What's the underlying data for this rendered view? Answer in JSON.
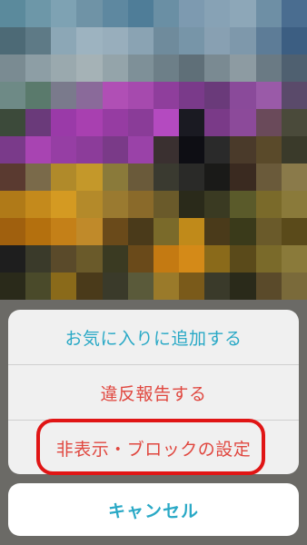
{
  "action_sheet": {
    "items": [
      {
        "label": "お気に入りに追加する",
        "color": "#2aa9c6"
      },
      {
        "label": "違反報告する",
        "color": "#e0473f"
      },
      {
        "label": "非表示・ブロックの設定",
        "color": "#e0473f"
      }
    ],
    "cancel_label": "キャンセル",
    "cancel_color": "#2aa9c6"
  },
  "annotation": {
    "highlight_color": "#e01515",
    "highlighted_item": "非表示・ブロックの設定"
  },
  "background_image": {
    "description": "pixelated mosaic photo",
    "palette": [
      "#5b8a9c",
      "#6d97a8",
      "#7ea2b3",
      "#6f93a6",
      "#5e88a0",
      "#4f7d98",
      "#6a8fa4",
      "#7d9ab0",
      "#87a2b5",
      "#8da7b8",
      "#6e8fa5",
      "#4a6d90",
      "#4d6a76",
      "#5e7a86",
      "#8ca7b6",
      "#9db3c0",
      "#98aebc",
      "#8aa3b3",
      "#6f8b9c",
      "#7795a8",
      "#88a0b2",
      "#7e98ab",
      "#5d7c97",
      "#3c5e82",
      "#7a8b92",
      "#8d9ea5",
      "#9aa9ae",
      "#a5b2b6",
      "#94a4aa",
      "#7e9098",
      "#6d7f88",
      "#5f6f78",
      "#7a8a92",
      "#8d9ba2",
      "#6a7a84",
      "#4f6070",
      "#6e8a86",
      "#5a7a6c",
      "#7a7a8c",
      "#8a6a9a",
      "#b04fb5",
      "#a64aae",
      "#8f3e9c",
      "#7a3a8a",
      "#6a3a7a",
      "#8a4a9a",
      "#9a5aa8",
      "#5a4a6a",
      "#3c4a3a",
      "#6a3a7a",
      "#9a3aa8",
      "#a840b0",
      "#963ca2",
      "#8a3c98",
      "#b44ac0",
      "#1a1a22",
      "#7a3a88",
      "#8c4a9a",
      "#6a4a5a",
      "#4a4a3a",
      "#7a3a8a",
      "#a844b2",
      "#963ea4",
      "#8c3c9a",
      "#7a3a88",
      "#9a42a8",
      "#3a3030",
      "#0e0e14",
      "#2a2a2a",
      "#4a3a2a",
      "#5a4a2a",
      "#3a3a2a",
      "#5a3a30",
      "#7a6a4a",
      "#b08a2a",
      "#c4982a",
      "#8a7a3a",
      "#6a5a3a",
      "#3a3a30",
      "#2a2a28",
      "#1a1a18",
      "#3a2a20",
      "#6a5a3a",
      "#8a7a4a",
      "#b07a18",
      "#c48a1c",
      "#d49a22",
      "#b48a2a",
      "#9a7a30",
      "#8a6a2a",
      "#6a5a2a",
      "#2a2a1a",
      "#3a3a22",
      "#5a5a2a",
      "#7a6a2a",
      "#8a7a3a",
      "#a0600e",
      "#b4700e",
      "#c48018",
      "#c08a2a",
      "#6a4a1a",
      "#4a3a1a",
      "#7a6a2a",
      "#c08a1a",
      "#4a3a1a",
      "#3a3a1a",
      "#6a5a2a",
      "#5a4a1a",
      "#1e1e1e",
      "#3a3a2a",
      "#5a4a2a",
      "#6a5a2a",
      "#3a3a22",
      "#6a4a1a",
      "#c47a12",
      "#d48a18",
      "#8a6a1a",
      "#5a4a1a",
      "#7a6a2a",
      "#8a7a3a",
      "#2a2a1a",
      "#4a4a2a",
      "#8a6a1a",
      "#4a3a1a",
      "#3a3a2a",
      "#5a5a3a",
      "#9a7a2a",
      "#7a5a1a",
      "#3a3a2a",
      "#2a2a1a",
      "#5a4a2a",
      "#7a6a3a",
      "#3a3a2a",
      "#5a5a3a",
      "#4a4a2a",
      "#3a3a22",
      "#4a3a1a",
      "#2a2a1a",
      "#3a3a2a",
      "#4a4a3a",
      "#3a3a2a",
      "#5a5a3a",
      "#6a6a4a",
      "#4a4a3a"
    ]
  }
}
